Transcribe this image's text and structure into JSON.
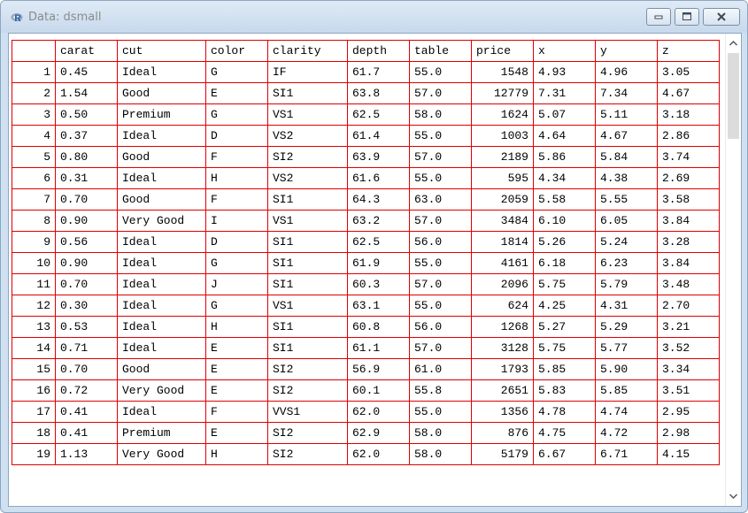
{
  "window": {
    "title": "Data: dsmall"
  },
  "chart_data": {
    "type": "table",
    "columns": [
      "carat",
      "cut",
      "color",
      "clarity",
      "depth",
      "table",
      "price",
      "x",
      "y",
      "z"
    ],
    "row_names": [
      "1",
      "2",
      "3",
      "4",
      "5",
      "6",
      "7",
      "8",
      "9",
      "10",
      "11",
      "12",
      "13",
      "14",
      "15",
      "16",
      "17",
      "18",
      "19"
    ],
    "rows": [
      [
        "0.45",
        "Ideal",
        "G",
        "IF",
        "61.7",
        "55.0",
        "1548",
        "4.93",
        "4.96",
        "3.05"
      ],
      [
        "1.54",
        "Good",
        "E",
        "SI1",
        "63.8",
        "57.0",
        "12779",
        "7.31",
        "7.34",
        "4.67"
      ],
      [
        "0.50",
        "Premium",
        "G",
        "VS1",
        "62.5",
        "58.0",
        "1624",
        "5.07",
        "5.11",
        "3.18"
      ],
      [
        "0.37",
        "Ideal",
        "D",
        "VS2",
        "61.4",
        "55.0",
        "1003",
        "4.64",
        "4.67",
        "2.86"
      ],
      [
        "0.80",
        "Good",
        "F",
        "SI2",
        "63.9",
        "57.0",
        "2189",
        "5.86",
        "5.84",
        "3.74"
      ],
      [
        "0.31",
        "Ideal",
        "H",
        "VS2",
        "61.6",
        "55.0",
        "595",
        "4.34",
        "4.38",
        "2.69"
      ],
      [
        "0.70",
        "Good",
        "F",
        "SI1",
        "64.3",
        "63.0",
        "2059",
        "5.58",
        "5.55",
        "3.58"
      ],
      [
        "0.90",
        "Very Good",
        "I",
        "VS1",
        "63.2",
        "57.0",
        "3484",
        "6.10",
        "6.05",
        "3.84"
      ],
      [
        "0.56",
        "Ideal",
        "D",
        "SI1",
        "62.5",
        "56.0",
        "1814",
        "5.26",
        "5.24",
        "3.28"
      ],
      [
        "0.90",
        "Ideal",
        "G",
        "SI1",
        "61.9",
        "55.0",
        "4161",
        "6.18",
        "6.23",
        "3.84"
      ],
      [
        "0.70",
        "Ideal",
        "J",
        "SI1",
        "60.3",
        "57.0",
        "2096",
        "5.75",
        "5.79",
        "3.48"
      ],
      [
        "0.30",
        "Ideal",
        "G",
        "VS1",
        "63.1",
        "55.0",
        "624",
        "4.25",
        "4.31",
        "2.70"
      ],
      [
        "0.53",
        "Ideal",
        "H",
        "SI1",
        "60.8",
        "56.0",
        "1268",
        "5.27",
        "5.29",
        "3.21"
      ],
      [
        "0.71",
        "Ideal",
        "E",
        "SI1",
        "61.1",
        "57.0",
        "3128",
        "5.75",
        "5.77",
        "3.52"
      ],
      [
        "0.70",
        "Good",
        "E",
        "SI2",
        "56.9",
        "61.0",
        "1793",
        "5.85",
        "5.90",
        "3.34"
      ],
      [
        "0.72",
        "Very Good",
        "E",
        "SI2",
        "60.1",
        "55.8",
        "2651",
        "5.83",
        "5.85",
        "3.51"
      ],
      [
        "0.41",
        "Ideal",
        "F",
        "VVS1",
        "62.0",
        "55.0",
        "1356",
        "4.78",
        "4.74",
        "2.95"
      ],
      [
        "0.41",
        "Premium",
        "E",
        "SI2",
        "62.9",
        "58.0",
        "876",
        "4.75",
        "4.72",
        "2.98"
      ],
      [
        "1.13",
        "Very Good",
        "H",
        "SI2",
        "62.0",
        "58.0",
        "5179",
        "6.67",
        "6.71",
        "4.15"
      ]
    ]
  },
  "icons": {
    "app": "r-logo-icon",
    "minimize": "minimize-icon",
    "maximize": "maximize-icon",
    "close": "close-icon",
    "scroll_up": "chevron-up-icon",
    "scroll_down": "chevron-down-icon"
  },
  "colors": {
    "grid_border": "#e00000",
    "titlebar": "#cfe0f1",
    "title_text": "#8a8a8a"
  }
}
